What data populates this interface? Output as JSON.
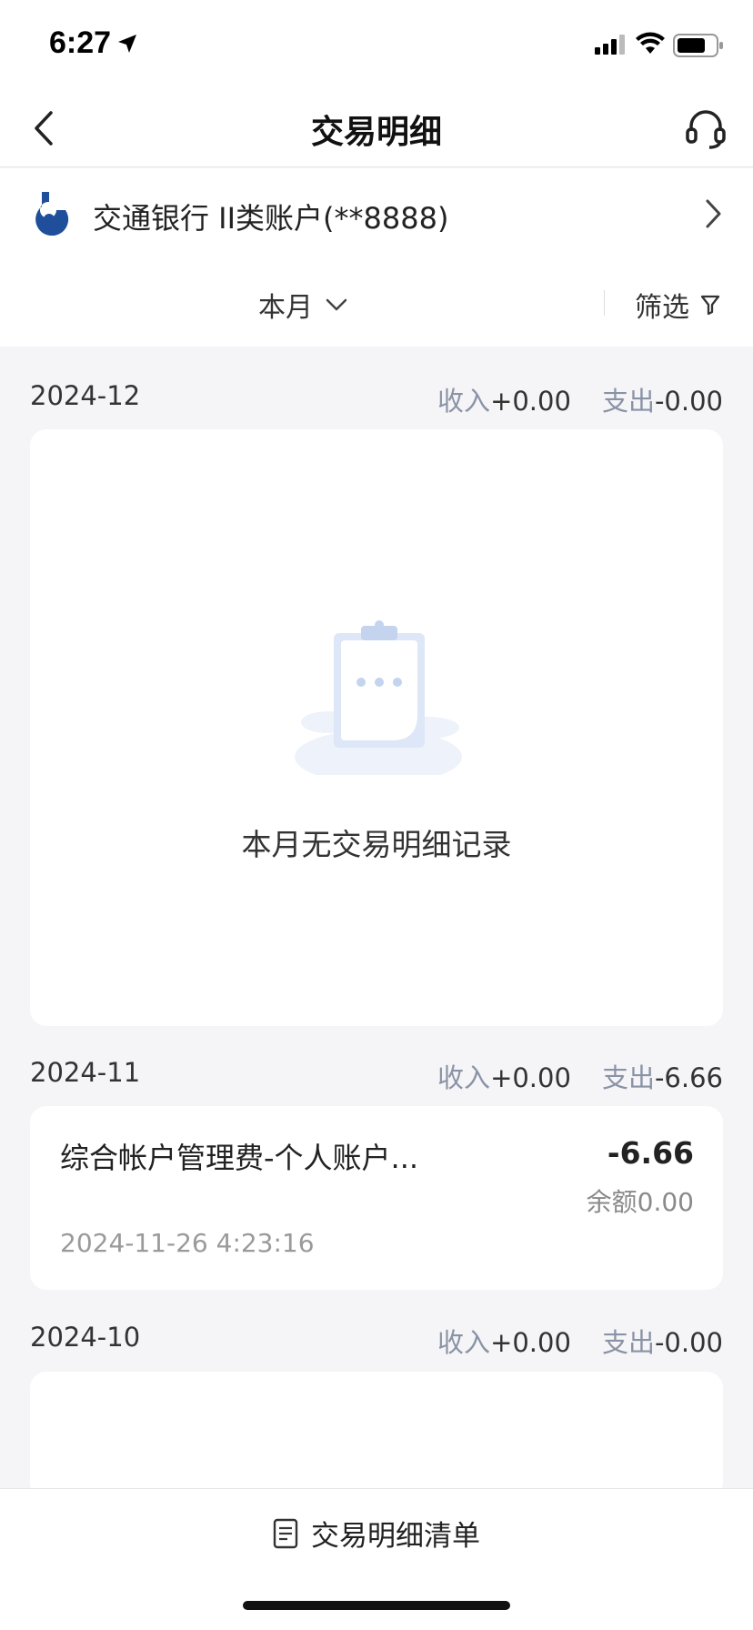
{
  "status_bar": {
    "time": "6:27"
  },
  "nav": {
    "title": "交易明细"
  },
  "account": {
    "name": "交通银行 II类账户(**8888)"
  },
  "filter": {
    "month_label": "本月",
    "filter_label": "筛选"
  },
  "months": [
    {
      "date": "2024-12",
      "income_label": "收入",
      "income_value": "+0.00",
      "expense_label": "支出",
      "expense_value": "-0.00",
      "empty_text": "本月无交易明细记录"
    },
    {
      "date": "2024-11",
      "income_label": "收入",
      "income_value": "+0.00",
      "expense_label": "支出",
      "expense_value": "-6.66",
      "transactions": [
        {
          "description": "综合帐户管理费-个人账户...",
          "amount": "-6.66",
          "balance": "余额0.00",
          "time": "2024-11-26 4:23:16"
        }
      ]
    },
    {
      "date": "2024-10",
      "income_label": "收入",
      "income_value": "+0.00",
      "expense_label": "支出",
      "expense_value": "-0.00"
    }
  ],
  "bottom": {
    "statement_label": "交易明细清单"
  },
  "icons": {
    "back": "chevron-left-icon",
    "service": "headset-icon",
    "bank": "bank-logo",
    "filter": "funnel-icon",
    "statement": "document-icon"
  },
  "colors": {
    "label_gray": "#8a93a6",
    "background": "#f5f5f7",
    "bank_blue": "#1f4e9b"
  }
}
